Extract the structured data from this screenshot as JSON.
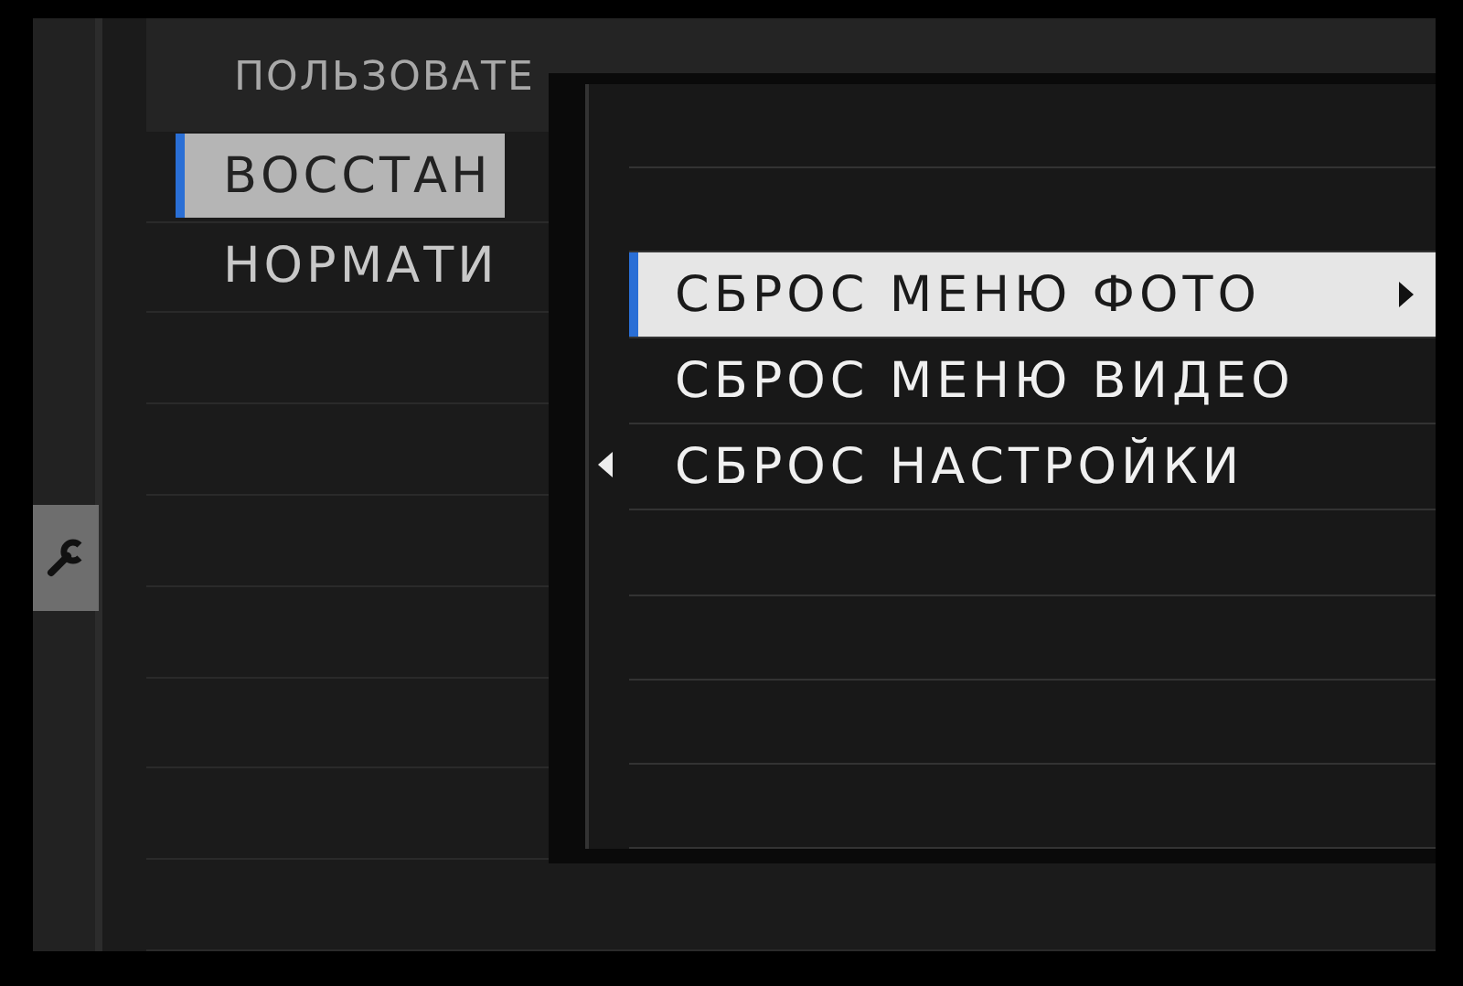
{
  "side_tab": {
    "selected": true
  },
  "menu": {
    "heading": "ПОЛЬЗОВАТЕ",
    "items": [
      {
        "label": "ВОССТАН",
        "selected": true
      },
      {
        "label": "НОРМАТИ",
        "selected": false
      }
    ]
  },
  "submenu": {
    "items": [
      {
        "label": "СБРОС МЕНЮ ФОТО",
        "selected": true,
        "has_submenu": true
      },
      {
        "label": "СБРОС МЕНЮ ВИДЕО",
        "selected": false,
        "has_submenu": false
      },
      {
        "label": "СБРОС НАСТРОЙКИ",
        "selected": false,
        "has_submenu": false
      }
    ]
  }
}
